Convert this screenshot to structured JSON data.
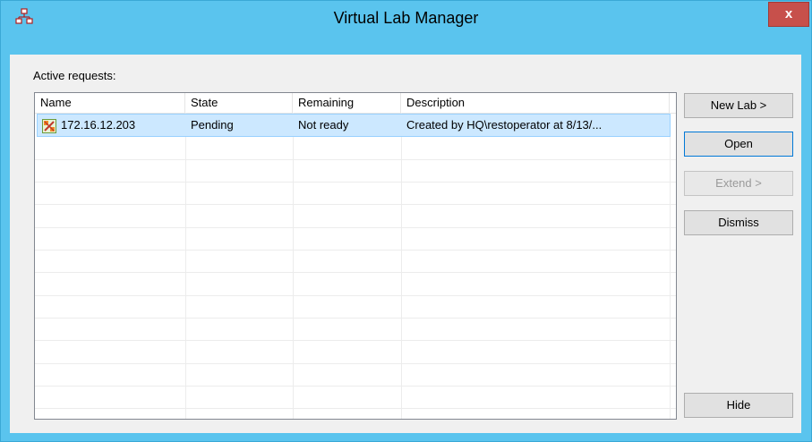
{
  "window": {
    "title": "Virtual Lab Manager",
    "close_glyph": "x"
  },
  "requests": {
    "label": "Active requests:",
    "columns": [
      "Name",
      "State",
      "Remaining",
      "Description"
    ],
    "rows": [
      {
        "icon": "lab-request-icon",
        "name": "172.16.12.203",
        "state": "Pending",
        "remaining": "Not ready",
        "description": "Created by HQ\\restoperator at 8/13/..."
      }
    ]
  },
  "buttons": {
    "new_lab": "New Lab >",
    "open": "Open",
    "extend": "Extend >",
    "dismiss": "Dismiss",
    "hide": "Hide"
  },
  "colors": {
    "title_bar": "#5ac4ee",
    "close_button": "#c7504b",
    "selection": "#cce8ff"
  }
}
